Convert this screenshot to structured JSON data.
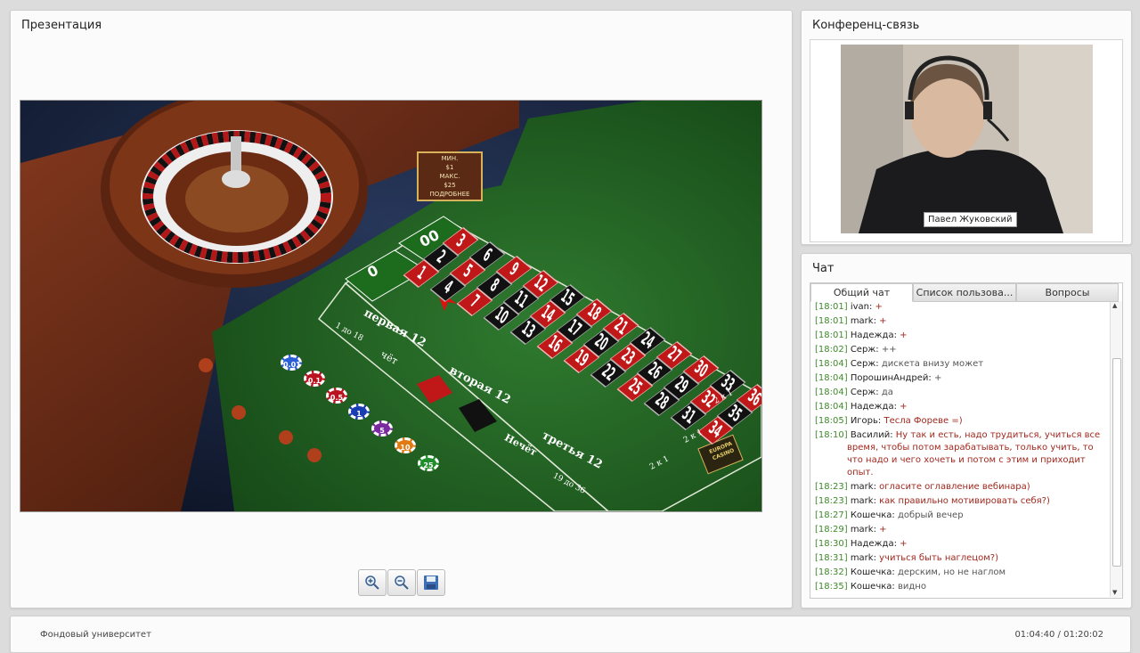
{
  "presentation": {
    "title": "Презентация",
    "slide": {
      "limits": [
        "МИН.",
        "$1",
        "МАКС.",
        "$25",
        "ПОДРОБНЕЕ"
      ],
      "zero": "0",
      "double_zero": "00",
      "board_numbers": [
        "3",
        "2",
        "1",
        "6",
        "5",
        "4",
        "9",
        "8",
        "7",
        "12",
        "11",
        "10",
        "15",
        "14",
        "13",
        "18",
        "17",
        "16",
        "21",
        "20",
        "19",
        "24",
        "23",
        "22",
        "27",
        "26",
        "25",
        "30",
        "29",
        "28",
        "33",
        "32",
        "31",
        "36",
        "35",
        "34"
      ],
      "dozens": [
        "первая 12",
        "вторая 12",
        "третья 12"
      ],
      "outside": [
        "1 до 18",
        "чёт",
        "Нечёт",
        "19 до 36"
      ],
      "column_bets": [
        "2 к 1",
        "2 к 1",
        "2 к 1"
      ],
      "chips": [
        "0.01",
        "0.1",
        "0.5",
        "1",
        "5",
        "10",
        "25"
      ],
      "logo": "EUROPA CASINO"
    },
    "toolbar": {
      "zoom_in_icon": "zoom-in-icon",
      "zoom_out_icon": "zoom-out-icon",
      "save_icon": "save-icon"
    }
  },
  "conference": {
    "title": "Конференц-связь",
    "speaker_name": "Павел Жуковский"
  },
  "chat": {
    "title": "Чат",
    "tabs": [
      "Общий чат",
      "Список пользова...",
      "Вопросы"
    ],
    "active_tab": 0,
    "messages": [
      {
        "time": "[18:01]",
        "name": "ivan:",
        "text": "+",
        "color": "red"
      },
      {
        "time": "[18:01]",
        "name": "mark:",
        "text": "+",
        "color": "red"
      },
      {
        "time": "[18:01]",
        "name": "Надежда:",
        "text": "+",
        "color": "red"
      },
      {
        "time": "[18:02]",
        "name": "Серж:",
        "text": "++",
        "color": "gray"
      },
      {
        "time": "[18:04]",
        "name": "Серж:",
        "text": "дискета внизу может",
        "color": "gray"
      },
      {
        "time": "[18:04]",
        "name": "ПорошинАндрей:",
        "text": "+",
        "color": "gray"
      },
      {
        "time": "[18:04]",
        "name": "Серж:",
        "text": "да",
        "color": "gray"
      },
      {
        "time": "[18:04]",
        "name": "Надежда:",
        "text": "+",
        "color": "red"
      },
      {
        "time": "[18:05]",
        "name": "Игорь:",
        "text": "Тесла Форевe =)",
        "color": "red"
      },
      {
        "time": "[18:10]",
        "name": "Василий:",
        "text": "Ну так и есть, надо трудиться, учиться все время, чтобы потом зарабатывать, только учить, то что надо и чего хочеть и потом с этим и приходит опыт.",
        "color": "red"
      },
      {
        "time": "[18:23]",
        "name": "mark:",
        "text": "огласите оглавление вебинара)",
        "color": "red"
      },
      {
        "time": "[18:23]",
        "name": "mark:",
        "text": "как правильно мотивировать себя?)",
        "color": "red"
      },
      {
        "time": "[18:27]",
        "name": "Кошечка:",
        "text": "добрый вечер",
        "color": "gray"
      },
      {
        "time": "[18:29]",
        "name": "mark:",
        "text": "+",
        "color": "red"
      },
      {
        "time": "[18:30]",
        "name": "Надежда:",
        "text": "+",
        "color": "red"
      },
      {
        "time": "[18:31]",
        "name": "mark:",
        "text": "учиться быть наглецом?)",
        "color": "red"
      },
      {
        "time": "[18:32]",
        "name": "Кошечка:",
        "text": "дерским, но не наглом",
        "color": "gray"
      },
      {
        "time": "[18:35]",
        "name": "Кошечка:",
        "text": "видно",
        "color": "gray"
      }
    ]
  },
  "footer": {
    "org": "Фондовый университет",
    "time": "01:04:40 / 01:20:02"
  }
}
